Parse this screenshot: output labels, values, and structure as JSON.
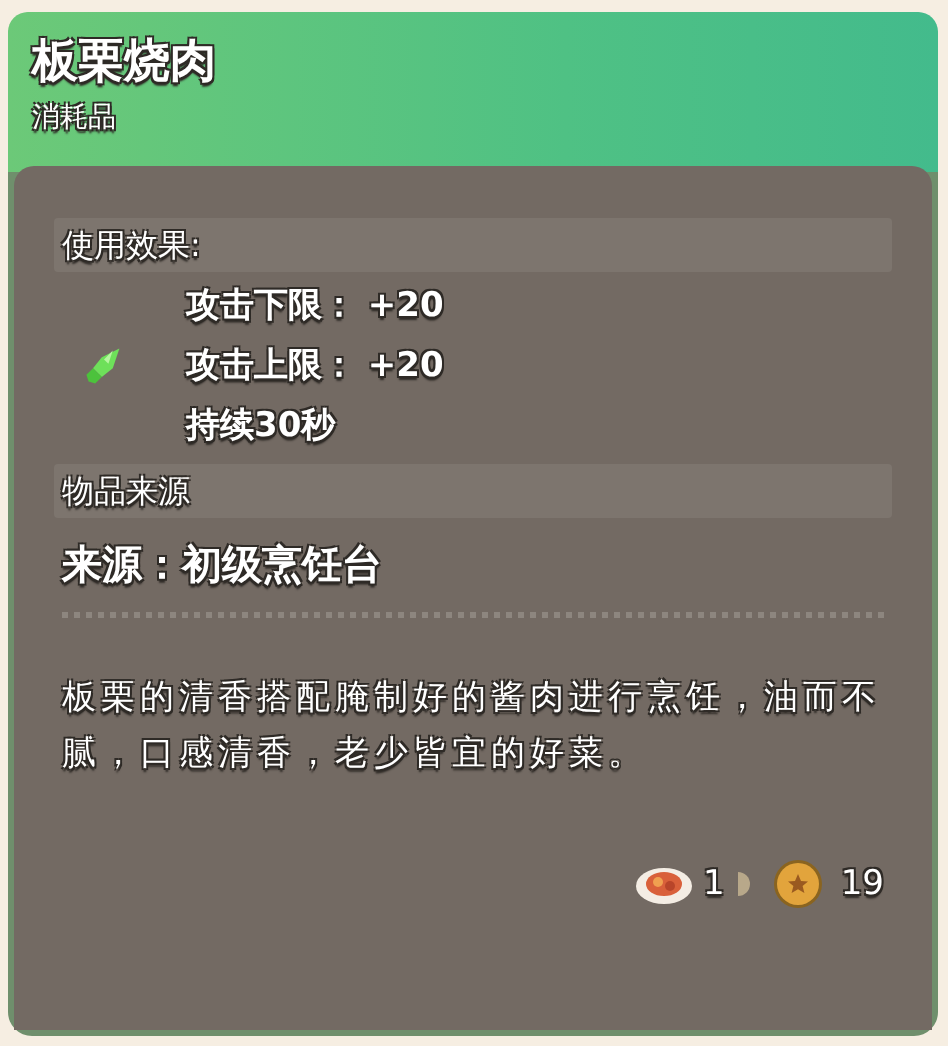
{
  "item": {
    "name": "板栗烧肉",
    "category": "消耗品"
  },
  "effects": {
    "title": "使用效果:",
    "lines": [
      "攻击下限： +20",
      "攻击上限： +20",
      "持续30秒"
    ]
  },
  "source": {
    "title": "物品来源",
    "text": "来源：初级烹饪台"
  },
  "description": "板栗的清香搭配腌制好的酱肉进行烹饪，油而不腻，口感清香，老少皆宜的好菜。",
  "footer": {
    "quantity": "1",
    "price": "19"
  }
}
